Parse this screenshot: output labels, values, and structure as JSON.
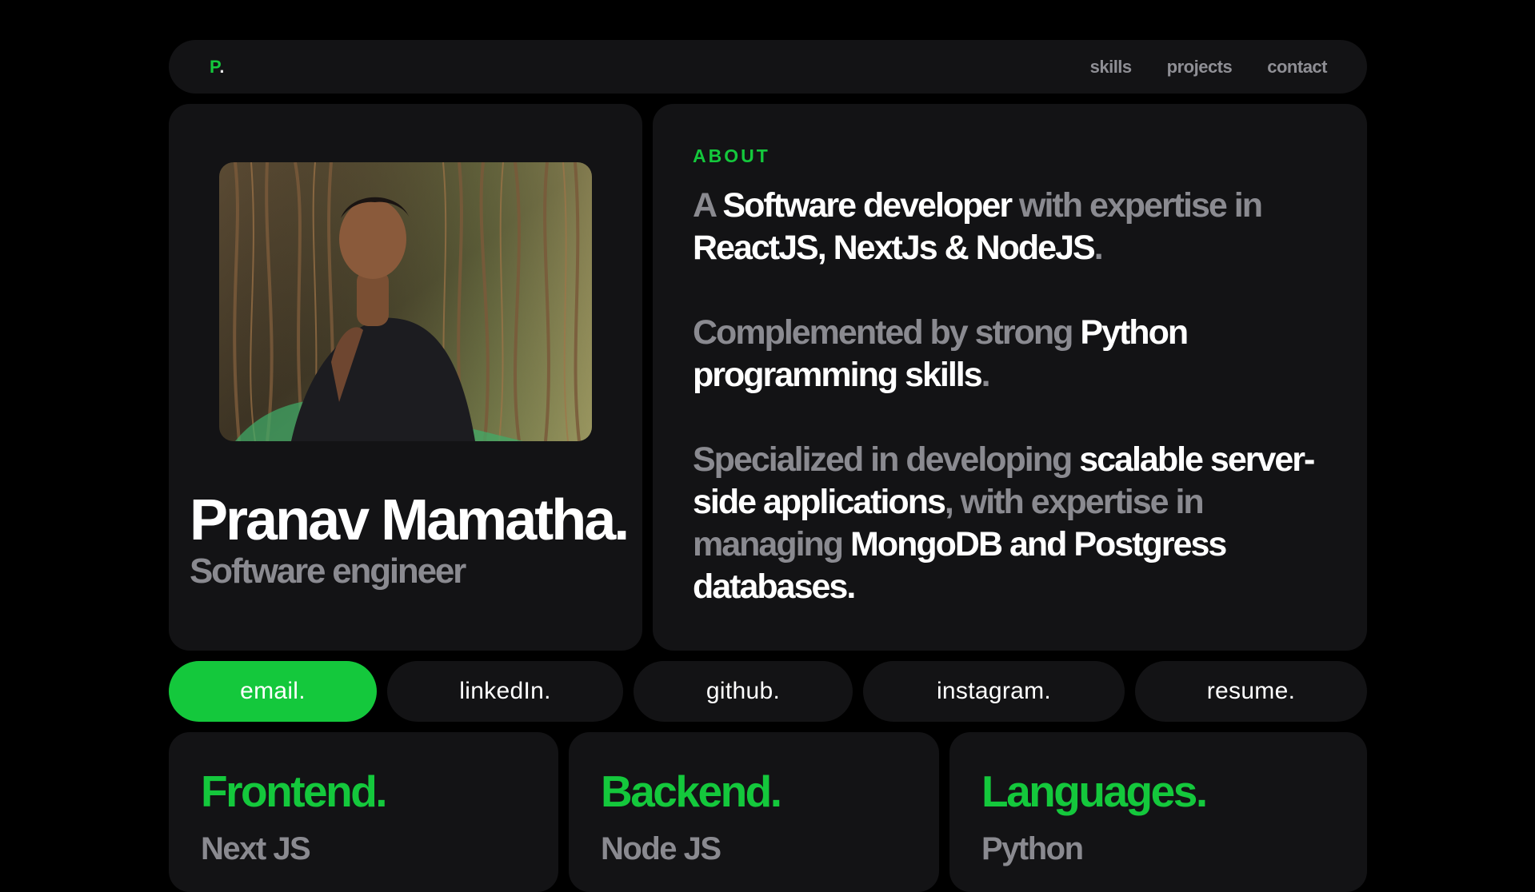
{
  "nav": {
    "logo_letter": "P",
    "logo_dot": ".",
    "links": [
      "skills",
      "projects",
      "contact"
    ]
  },
  "profile": {
    "name": "Pranav Mamatha.",
    "role": "Software engineer"
  },
  "about": {
    "label": "ABOUT",
    "p1": {
      "a": "A ",
      "b": "Software developer",
      "c": " with expertise in ",
      "d": "ReactJS, NextJs & NodeJS",
      "e": "."
    },
    "p2": {
      "a": "Complemented by strong ",
      "b": "Python programming skills",
      "c": "."
    },
    "p3": {
      "a": "Specialized in developing ",
      "b": "scalable server-side applications",
      "c": ", with expertise in managing ",
      "d": "MongoDB and Postgress databases."
    }
  },
  "socials": [
    "email.",
    "linkedIn.",
    "github.",
    "instagram.",
    "resume."
  ],
  "skills": [
    {
      "title": "Frontend.",
      "first": "Next JS"
    },
    {
      "title": "Backend.",
      "first": "Node JS"
    },
    {
      "title": "Languages.",
      "first": "Python"
    }
  ],
  "colors": {
    "accent": "#14c83c",
    "card": "#131315",
    "muted": "#8a8a90",
    "background": "#000000"
  }
}
